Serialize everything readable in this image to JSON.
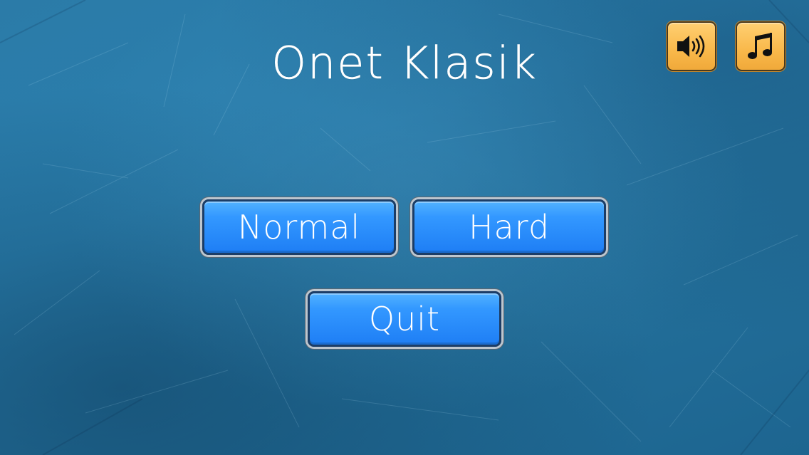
{
  "game": {
    "title": "Onet Klasik"
  },
  "menu": {
    "normal_label": "Normal",
    "hard_label": "Hard",
    "quit_label": "Quit"
  },
  "toolbar": {
    "sound_icon": "speaker-icon",
    "music_icon": "music-note-icon"
  },
  "colors": {
    "background": "#2a7fae",
    "button_blue": "#3398ff",
    "icon_button_orange": "#f9b84a",
    "text": "#ffffff"
  }
}
